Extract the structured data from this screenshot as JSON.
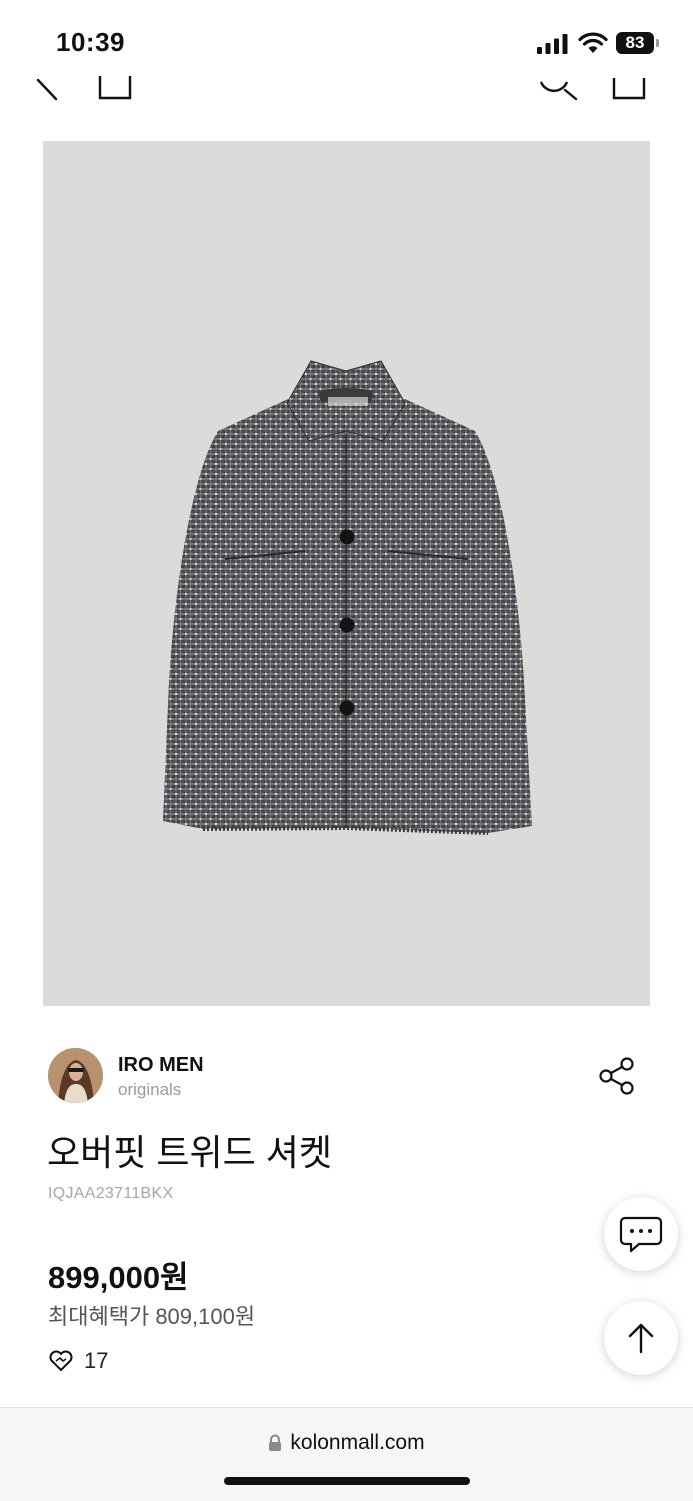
{
  "status_bar": {
    "time": "10:39",
    "battery": "83"
  },
  "product": {
    "brand_name": "IRO MEN",
    "brand_sub": "originals",
    "title": "오버핏 트위드 셔켓",
    "code": "IQJAA23711BKX",
    "price": "899,000원",
    "benefit_price": "최대혜택가 809,100원",
    "like_count": "17"
  },
  "browser": {
    "url": "kolonmall.com"
  },
  "icons": {
    "back": "back-icon",
    "home": "home-icon",
    "search": "search-icon",
    "cart": "cart-icon",
    "share": "share-icon",
    "chat": "chat-icon",
    "arrow_up": "arrow-up-icon",
    "heart": "heart-icon",
    "lock": "lock-icon"
  },
  "colors": {
    "image_background": "#dcdbd9",
    "jacket": "#4a4a4d",
    "text_primary": "#111111",
    "text_muted": "#9a9a9a"
  }
}
